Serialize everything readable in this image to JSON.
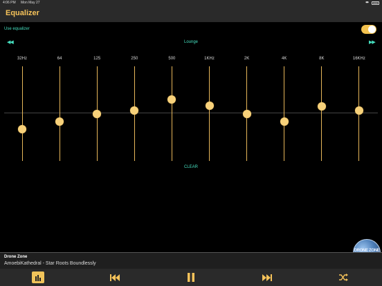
{
  "status_bar": {
    "time": "4:06 PM",
    "date": "Mon May 27"
  },
  "header": {
    "title": "Equalizer"
  },
  "equalizer": {
    "use_label": "Use equalizer",
    "enabled": true,
    "preset": "Lounge",
    "clear_label": "CLEAR",
    "bands": [
      {
        "label": "32Hz",
        "level": -0.35
      },
      {
        "label": "64",
        "level": -0.18
      },
      {
        "label": "125",
        "level": 0.0
      },
      {
        "label": "250",
        "level": 0.07
      },
      {
        "label": "500",
        "level": 0.31
      },
      {
        "label": "1KHz",
        "level": 0.17
      },
      {
        "label": "2K",
        "level": 0.0
      },
      {
        "label": "4K",
        "level": -0.18
      },
      {
        "label": "8K",
        "level": 0.16
      },
      {
        "label": "16KHz",
        "level": 0.07
      }
    ]
  },
  "now_playing": {
    "station": "Drone Zone",
    "track": "AmoebiKathedral - Star Roots Boundlessly",
    "artwork_text": "DRONE ZONE"
  },
  "toolbar": {
    "items": [
      "equalizer-icon",
      "previous-icon",
      "pause-icon",
      "next-icon",
      "shuffle-icon"
    ]
  },
  "colors": {
    "accent": "#f6c35a",
    "teal": "#46e0c0",
    "slider": "#e9b85a",
    "background": "#000000"
  }
}
